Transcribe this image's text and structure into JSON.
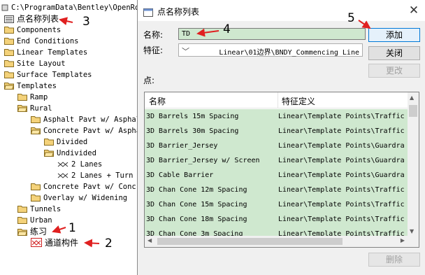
{
  "tree": {
    "path": "C:\\ProgramData\\Bentley\\OpenRoad",
    "items": [
      {
        "label": "点名称列表",
        "icon": "list-icon",
        "depth": 0,
        "cjk": true
      },
      {
        "label": "Components",
        "icon": "folder-icon",
        "depth": 0
      },
      {
        "label": "End Conditions",
        "icon": "folder-icon",
        "depth": 0
      },
      {
        "label": "Linear Templates",
        "icon": "folder-icon",
        "depth": 0
      },
      {
        "label": "Site Layout",
        "icon": "folder-icon",
        "depth": 0
      },
      {
        "label": "Surface Templates",
        "icon": "folder-icon",
        "depth": 0
      },
      {
        "label": "Templates",
        "icon": "folder-open-icon",
        "depth": 0
      },
      {
        "label": "Ramp",
        "icon": "folder-icon",
        "depth": 1
      },
      {
        "label": "Rural",
        "icon": "folder-open-icon",
        "depth": 1
      },
      {
        "label": "Asphalt Pavt w/ Asphal",
        "icon": "folder-icon",
        "depth": 2
      },
      {
        "label": "Concrete Pavt w/ Aspha",
        "icon": "folder-open-icon",
        "depth": 2
      },
      {
        "label": "Divided",
        "icon": "folder-icon",
        "depth": 3
      },
      {
        "label": "Undivided",
        "icon": "folder-open-icon",
        "depth": 3
      },
      {
        "label": "2 Lanes",
        "icon": "template-icon",
        "depth": 4
      },
      {
        "label": "2 Lanes + Turn",
        "icon": "template-icon",
        "depth": 4
      },
      {
        "label": "Concrete Pavt w/ Conc",
        "icon": "folder-icon",
        "depth": 2
      },
      {
        "label": "Overlay w/ Widening",
        "icon": "folder-icon",
        "depth": 2
      },
      {
        "label": "Tunnels",
        "icon": "folder-icon",
        "depth": 1
      },
      {
        "label": "Urban",
        "icon": "folder-icon",
        "depth": 1
      },
      {
        "label": "练习",
        "icon": "folder-open-icon",
        "depth": 1,
        "cjk": true
      },
      {
        "label": "通道构件",
        "icon": "template-red-icon",
        "depth": 2,
        "cjk": true
      }
    ]
  },
  "dialog": {
    "title": "点名称列表",
    "name_label": "名称:",
    "name_value": "TD",
    "feature_label": "特征:",
    "feature_value": "Linear\\01边界\\BNDY_Commencing Line",
    "points_label": "点:",
    "buttons": {
      "add": "添加",
      "close": "关闭",
      "change": "更改",
      "delete": "删除"
    },
    "columns": [
      "名称",
      "特征定义"
    ],
    "rows": [
      [
        "3D Barrels 15m Spacing",
        "Linear\\Template Points\\Traffic"
      ],
      [
        "3D Barrels 30m Spacing",
        "Linear\\Template Points\\Traffic"
      ],
      [
        "3D Barrier_Jersey",
        "Linear\\Template Points\\Guardra"
      ],
      [
        "3D Barrier_Jersey w/ Screen",
        "Linear\\Template Points\\Guardra"
      ],
      [
        "3D Cable Barrier",
        "Linear\\Template Points\\Guardra"
      ],
      [
        "3D Chan Cone 12m Spacing",
        "Linear\\Template Points\\Traffic"
      ],
      [
        "3D Chan Cone 15m Spacing",
        "Linear\\Template Points\\Traffic"
      ],
      [
        "3D Chan Cone 18m Spacing",
        "Linear\\Template Points\\Traffic"
      ],
      [
        "3D Chan Cone 3m Spacing",
        "Linear\\Template Points\\Traffic"
      ]
    ]
  },
  "annotations": [
    "1",
    "2",
    "3",
    "4",
    "5"
  ],
  "colors": {
    "highlight": "#cfe8cf",
    "accent": "#0078d7",
    "arrow": "#e02020"
  }
}
